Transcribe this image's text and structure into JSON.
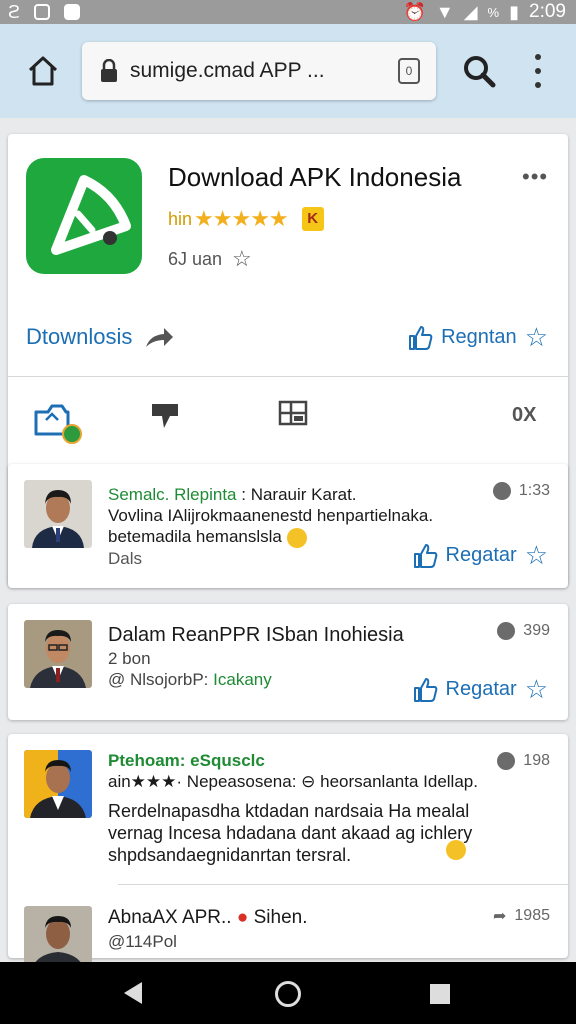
{
  "status_bar": {
    "time": "2:09",
    "battery": "%"
  },
  "browser": {
    "url": "sumige.cmad APP ...",
    "tab_count": "0"
  },
  "app": {
    "title": "Download APK Indonesia",
    "rating_prefix": "hin",
    "stars": "★★★★★",
    "badge": "K",
    "meta": "6J uan",
    "download_label": "Dtownlosis",
    "regular_label": "Regntan",
    "toolbar_right": "0X"
  },
  "posts": [
    {
      "name": "Semalc. Rlepinta",
      "lead": ": Narauir Karat.",
      "line2": "Vovlina IAlijrokmaanenestd henpartielnaka.",
      "line3": "betemadila hemanslsla",
      "line4": "Dals",
      "meta": "1:33",
      "action": "Regatar"
    },
    {
      "title": "Dalam ReanPPR ISban Inohiesia",
      "line2": "2 bon",
      "mention_prefix": "@ NlsojorbP:",
      "mention": "Icakany",
      "meta": "399",
      "action": "Regatar"
    },
    {
      "name": "Ptehoam: eSqusclc",
      "line1b": "ain★★★· Nepeasosena: ⊖ heorsanlanta Idellap.",
      "line2": "Rerdelnapasdha ktdadan nardsaia Ha mealal",
      "line3": "vernag Incesa hdadana dant akaad ag ichlery",
      "line4": "shpdsandaegnidanrtan tersral.",
      "meta": "198"
    },
    {
      "title": "AbnaAX APR..",
      "status": "Sihen.",
      "handle": "@114Pol",
      "meta": "1985"
    }
  ],
  "colors": {
    "accent": "#1d6fb5",
    "green": "#1fa83e",
    "url_bar": "#cfe3f1"
  }
}
